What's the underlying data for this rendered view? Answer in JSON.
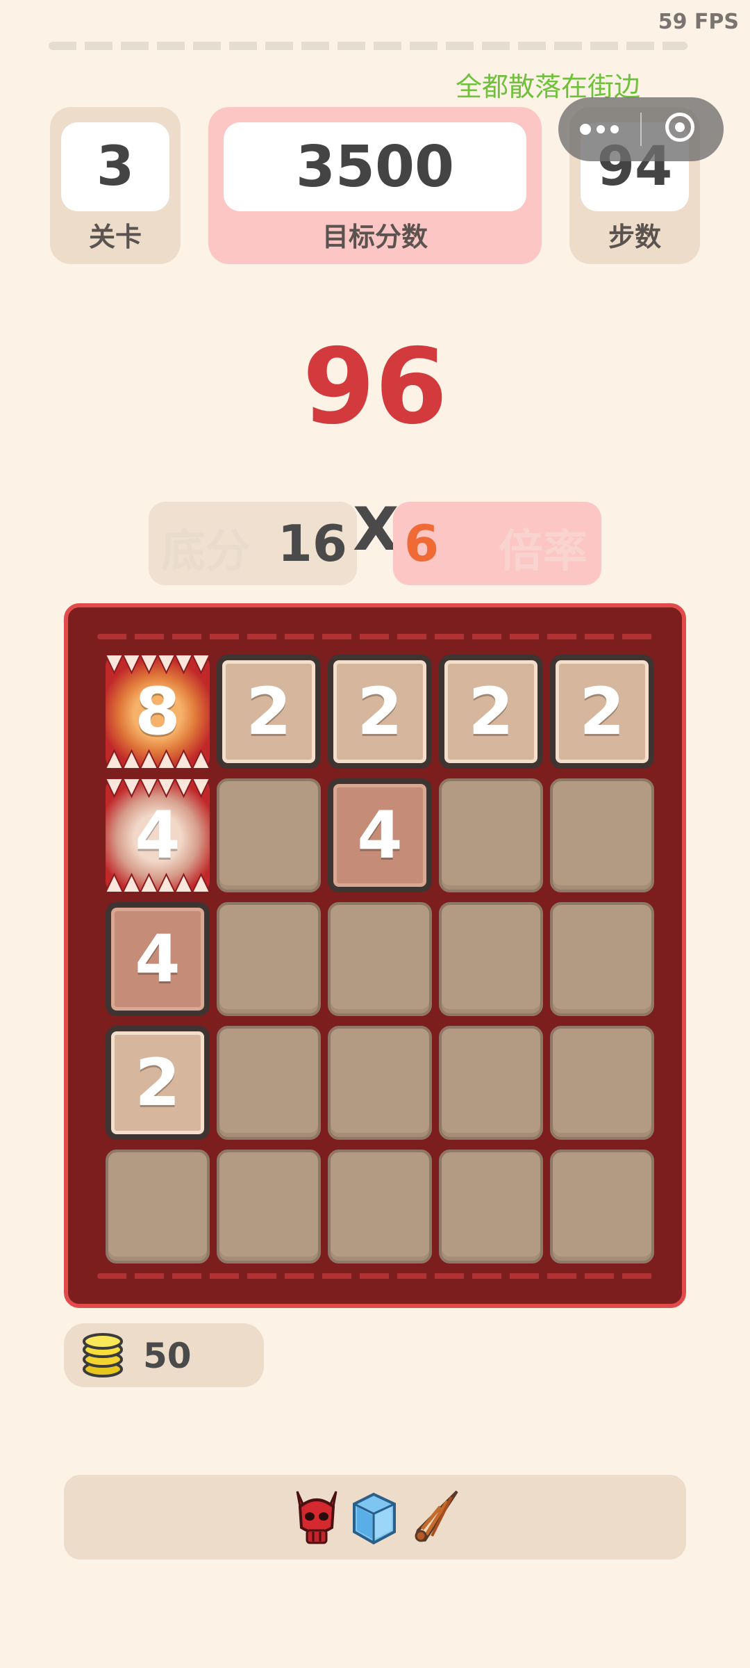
{
  "status": {
    "fps": "59 FPS"
  },
  "song": {
    "text": "全都散落在街边"
  },
  "stats": {
    "level": {
      "value": "3",
      "label": "关卡"
    },
    "target": {
      "value": "3500",
      "label": "目标分数"
    },
    "steps": {
      "value": "94",
      "label": "步数"
    }
  },
  "score": {
    "value": "96"
  },
  "formula": {
    "base_label": "底分",
    "base_value": "16",
    "times": "X",
    "multiplier_value": "6",
    "multiplier_label": "倍率"
  },
  "board": {
    "rows": [
      [
        {
          "v": "8",
          "kind": "monster"
        },
        {
          "v": "2",
          "kind": "t2"
        },
        {
          "v": "2",
          "kind": "t2"
        },
        {
          "v": "2",
          "kind": "t2"
        },
        {
          "v": "2",
          "kind": "t2"
        }
      ],
      [
        {
          "v": "4",
          "kind": "monster4"
        },
        {
          "v": "",
          "kind": "empty"
        },
        {
          "v": "4",
          "kind": "t4"
        },
        {
          "v": "",
          "kind": "empty"
        },
        {
          "v": "",
          "kind": "empty"
        }
      ],
      [
        {
          "v": "4",
          "kind": "t4"
        },
        {
          "v": "",
          "kind": "empty"
        },
        {
          "v": "",
          "kind": "empty"
        },
        {
          "v": "",
          "kind": "empty"
        },
        {
          "v": "",
          "kind": "empty"
        }
      ],
      [
        {
          "v": "2",
          "kind": "t2"
        },
        {
          "v": "",
          "kind": "empty"
        },
        {
          "v": "",
          "kind": "empty"
        },
        {
          "v": "",
          "kind": "empty"
        },
        {
          "v": "",
          "kind": "empty"
        }
      ],
      [
        {
          "v": "",
          "kind": "empty"
        },
        {
          "v": "",
          "kind": "empty"
        },
        {
          "v": "",
          "kind": "empty"
        },
        {
          "v": "",
          "kind": "empty"
        },
        {
          "v": "",
          "kind": "empty"
        }
      ]
    ]
  },
  "coins": {
    "value": "50",
    "icon": "coin-stack-icon"
  },
  "items": [
    {
      "icon": "devil-skull-icon"
    },
    {
      "icon": "ice-cube-icon"
    },
    {
      "icon": "drill-shell-icon"
    }
  ],
  "colors": {
    "background": "#fcf2e6",
    "score": "#d23a3e",
    "board": "#7c1d1e",
    "board_border": "#e14b4b",
    "multiplier": "#f06a35",
    "song": "#6fc13c"
  }
}
